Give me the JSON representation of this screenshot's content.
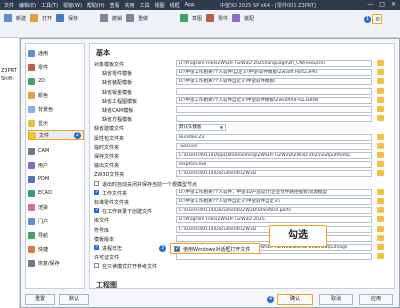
{
  "app": {
    "menu": [
      "文件",
      "编辑(E)",
      "工具(T)",
      "视窗(W)",
      "帮助(H)",
      "查看",
      "实用",
      "工具",
      "视图",
      "线框",
      "App"
    ],
    "title": "中望3D 2025 SP x64 - [零件001.Z3PRT]",
    "window_controls": [
      "—",
      "□",
      "✕"
    ]
  },
  "ribbon": {
    "items": [
      "新建",
      "打开",
      "保存",
      "撤销",
      "重做",
      "草图",
      "零件",
      "装配"
    ],
    "badge": "1"
  },
  "left_strip": [
    "",
    "Z3PRT",
    "Shift-"
  ],
  "sidebar": {
    "items": [
      {
        "label": "通用",
        "icon": "general-icon"
      },
      {
        "label": "零件",
        "icon": "part-icon"
      },
      {
        "label": "2D",
        "icon": "2d-icon"
      },
      {
        "label": "颜色",
        "icon": "color-icon"
      },
      {
        "label": "背景色",
        "icon": "background-icon"
      },
      {
        "label": "显示",
        "icon": "display-icon"
      },
      {
        "label": "文件",
        "icon": "file-icon"
      },
      {
        "label": "CAM",
        "icon": "cam-icon"
      },
      {
        "label": "用户",
        "icon": "user-icon"
      },
      {
        "label": "PDM",
        "icon": "pdm-icon"
      },
      {
        "label": "ECAD",
        "icon": "ecad-icon"
      },
      {
        "label": "渲染",
        "icon": "render-icon"
      },
      {
        "label": "门户",
        "icon": "portal-icon"
      },
      {
        "label": "导航",
        "icon": "nav-icon"
      },
      {
        "label": "快捷",
        "icon": "shortcut-icon"
      },
      {
        "label": "恢复/保存",
        "icon": "recovery-icon"
      }
    ],
    "badge": "2"
  },
  "content": {
    "section_title": "基本",
    "rows": [
      {
        "type": "path",
        "label": "对象模板文件",
        "value": "D:\\Program Files\\ZWSOFT\\ZW3D 2025\\language\\zh_CN\\resource\\"
      },
      {
        "type": "path",
        "label": "缺省零件模板",
        "value": "D:\\中望工作相关\\个人软件\\自定义\\中望\\软件模板\\Zwsoft PartZ3PRT",
        "indent": true
      },
      {
        "type": "path",
        "label": "缺省装配模板",
        "value": "D:\\中望工作相关\\个人软件自定义\\中望软件模板\\",
        "indent": true
      },
      {
        "type": "path",
        "label": "缺省钣金模板",
        "value": "",
        "indent": true
      },
      {
        "type": "path",
        "label": "缺省工程图模板",
        "value": "D:\\中望工作相关\\个人软件自定义\\中望软件模板\\ZwsoftA4-HZ3DRW",
        "indent": true
      },
      {
        "type": "path",
        "label": "缺省CAM模板",
        "value": "",
        "indent": true
      },
      {
        "type": "path",
        "label": "缺省方程模板",
        "value": "",
        "indent": true
      },
      {
        "type": "dropdown",
        "label": "缺省建模文件",
        "value": "默认头模板"
      },
      {
        "type": "path",
        "label": "属性包文件夹",
        "value": "Bundles.Z3"
      },
      {
        "type": "path",
        "label": "临时文件夹",
        "value": ".Session"
      },
      {
        "type": "path",
        "label": "保存文件夹",
        "value": "C:\\Users\\49114\\AppData\\Roaming\\ZWSOFT\\ZW3D\\ZW3D 2025\\output\\temp"
      },
      {
        "type": "path",
        "label": "输出文件夹",
        "value": "lexpfonl.exe"
      },
      {
        "type": "path",
        "label": "ZW3D文件夹",
        "value": "C:\\Users\\49114\\Documents\\ZW3D"
      },
      {
        "type": "check",
        "label": "退出时自动关闭并保存当前一个根模型节点",
        "checked": false
      },
      {
        "type": "checkpath",
        "label": "工作文件夹",
        "value": "D:\\中望工作相关\\个人软件，中望3D产品设计\\企业文件路径规划\\资源模型",
        "checked": true
      },
      {
        "type": "path",
        "label": "标准零件文件夹",
        "value": "D:\\中望工作相关\\个人软件自定义\\中望软件自定义\\"
      },
      {
        "type": "checkpath",
        "label": "在工作目录下创建文件",
        "value": "C:\\Users\\49114\\Documents\\ZW3D\\Standard parts",
        "checked": true
      },
      {
        "type": "path",
        "label": "库文件",
        "value": "D:\\Program Files\\ZWSOFT\\ZW3D 2025"
      },
      {
        "type": "path",
        "label": "符号库",
        "value": "C:\\Users\\49114\\Documents\\ZW3D"
      },
      {
        "type": "path",
        "label": "模板版本",
        "value": ""
      },
      {
        "type": "checkpath",
        "label": "进程日志",
        "value": "C:\\Users\\49114\\AppData\\Roaming\\ZWSOFT\\ZW3D\\ZW3D 2025\\output\\logs",
        "checked": true
      },
      {
        "type": "path",
        "label": "许可证文件",
        "value": ""
      },
      {
        "type": "check",
        "label": "在只读模式打开参考文件",
        "checked": false
      }
    ],
    "highlight_option": "使用Windows对话框打开文件",
    "badge3": "3",
    "cad_section": "工程图"
  },
  "callout": {
    "text": "勾选"
  },
  "footer": {
    "reset": "重置",
    "default": "默认",
    "ok": "确认",
    "cancel": "取消",
    "apply": "应用",
    "badge4": "4"
  }
}
